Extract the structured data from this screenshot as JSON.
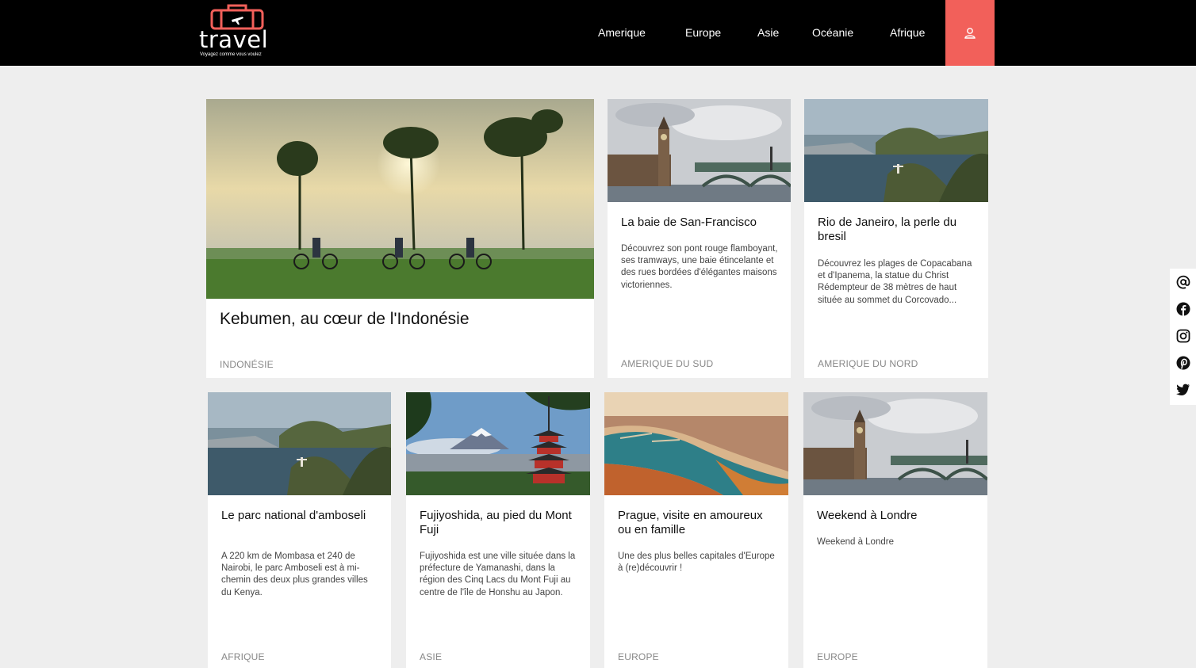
{
  "header": {
    "logo_text": "travel",
    "logo_tagline": "Voyagez comme vous voulez",
    "nav": [
      "Amerique",
      "Europe",
      "Asie",
      "Océanie",
      "Afrique"
    ],
    "account_icon": "user-icon",
    "accent_color": "#f2605a"
  },
  "featured": {
    "title": "Kebumen, au cœur de l'Indonésie",
    "tag": "INDONÉSIE"
  },
  "cards": [
    {
      "title": "La baie de San-Francisco",
      "desc": "Découvrez son pont rouge flamboyant, ses tramways, une baie étincelante et des rues bordées d'élégantes maisons victoriennes.",
      "tag": "AMERIQUE DU SUD"
    },
    {
      "title": "Rio de Janeiro, la perle du bresil",
      "desc": "Découvrez les plages de Copacabana et d'Ipanema, la statue du Christ Rédempteur de 38 mètres de haut située au sommet du Corcovado...",
      "tag": "AMERIQUE DU NORD"
    },
    {
      "title": "Le parc national d'amboseli",
      "desc": "A 220 km de Mombasa et 240 de Nairobi, le parc Amboseli est à mi-chemin des deux plus grandes villes du Kenya.",
      "tag": "AFRIQUE"
    },
    {
      "title": "Fujiyoshida, au pied du Mont Fuji",
      "desc": "Fujiyoshida est une ville située dans la préfecture de Yamanashi, dans la région des Cinq Lacs du Mont Fuji au centre de l'île de Honshu au Japon.",
      "tag": "ASIE"
    },
    {
      "title": "Prague, visite en amoureux ou en famille",
      "desc": "Une des plus belles capitales d'Europe à (re)découvrir !",
      "tag": "EUROPE"
    },
    {
      "title": "Weekend à Londre",
      "desc": "Weekend à Londre",
      "tag": "EUROPE"
    }
  ],
  "social": [
    "at-icon",
    "facebook-icon",
    "instagram-icon",
    "pinterest-icon",
    "twitter-icon"
  ]
}
